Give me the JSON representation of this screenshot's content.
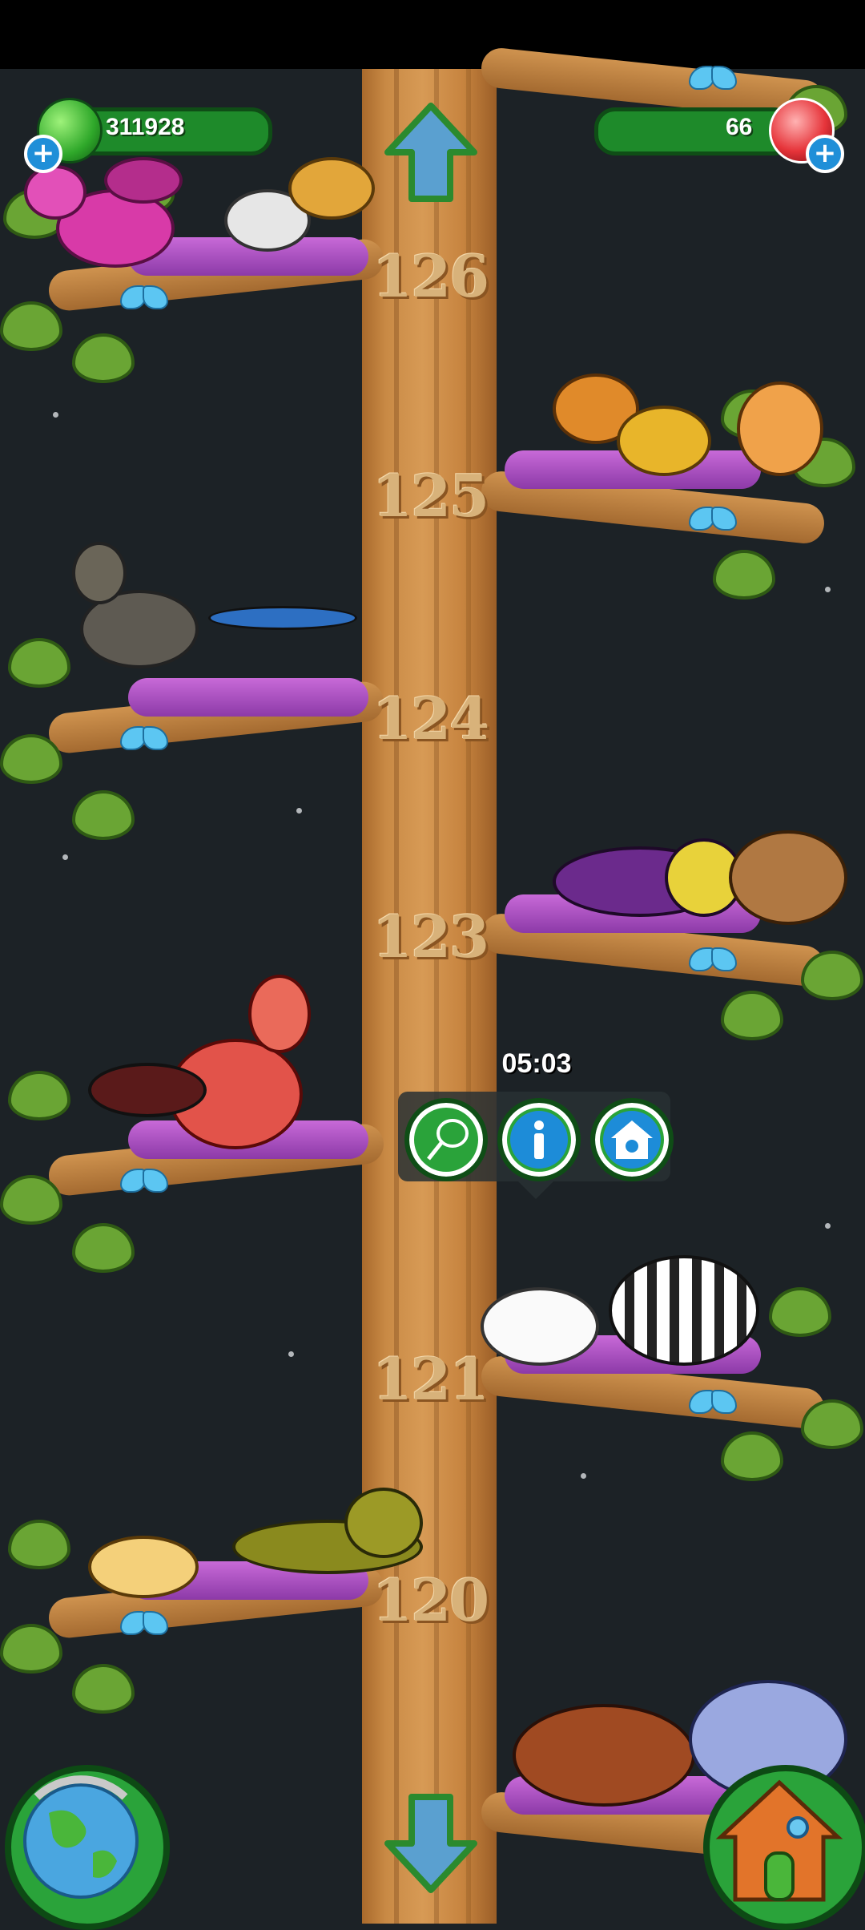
{
  "hud": {
    "coins_value": "311928",
    "gems_value": "66",
    "add_coins_label": "+",
    "add_gems_label": "+"
  },
  "levels": [
    "126",
    "125",
    "124",
    "123",
    "121",
    "120"
  ],
  "popup": {
    "timer": "05:03",
    "buttons": [
      {
        "icon": "net-icon"
      },
      {
        "icon": "info-icon"
      },
      {
        "icon": "animal-house-icon"
      }
    ]
  },
  "colors": {
    "background": "#1c2226",
    "hud_green": "#1e8a2a",
    "trunk": "#c98a45",
    "leaf": "#6aa534",
    "nest": "#b055c8",
    "butterfly": "#5cc6f2"
  },
  "icons": {
    "up_arrow": "up-arrow-icon",
    "down_arrow": "down-arrow-icon",
    "globe": "globe-icon",
    "house": "house-icon",
    "coin": "green-gem-icon",
    "gem": "red-crystal-icon"
  }
}
